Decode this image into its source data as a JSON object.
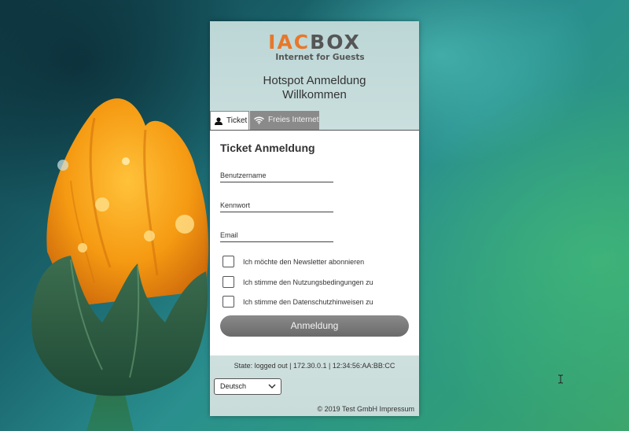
{
  "logo": {
    "part1": "IAC",
    "part2": "BOX",
    "tagline": "Internet for Guests"
  },
  "heading": {
    "line1": "Hotspot Anmeldung",
    "line2": "Willkommen"
  },
  "tabs": [
    {
      "label": "Ticket",
      "icon": "user-icon",
      "active": true
    },
    {
      "label": "Freies Internet",
      "icon": "wifi-icon",
      "active": false
    }
  ],
  "form": {
    "title": "Ticket Anmeldung",
    "username_placeholder": "Benutzername",
    "password_placeholder": "Kennwort",
    "email_placeholder": "Email",
    "checkboxes": [
      {
        "label": "Ich möchte den Newsletter abonnieren",
        "checked": false
      },
      {
        "label": "Ich stimme den Nutzungsbedingungen zu",
        "checked": false
      },
      {
        "label": "Ich stimme den Datenschutzhinweisen zu",
        "checked": false
      }
    ],
    "submit_label": "Anmeldung"
  },
  "status": "State: logged out | 172.30.0.1 | 12:34:56:AA:BB:CC",
  "language": {
    "selected": "Deutsch"
  },
  "footer": {
    "copyright": "© 2019 Test GmbH",
    "impressum": "Impressum"
  },
  "colors": {
    "brand_orange": "#e8772a",
    "brand_gray": "#555555",
    "tab_inactive": "#8a8a8a",
    "button": "#777777"
  }
}
